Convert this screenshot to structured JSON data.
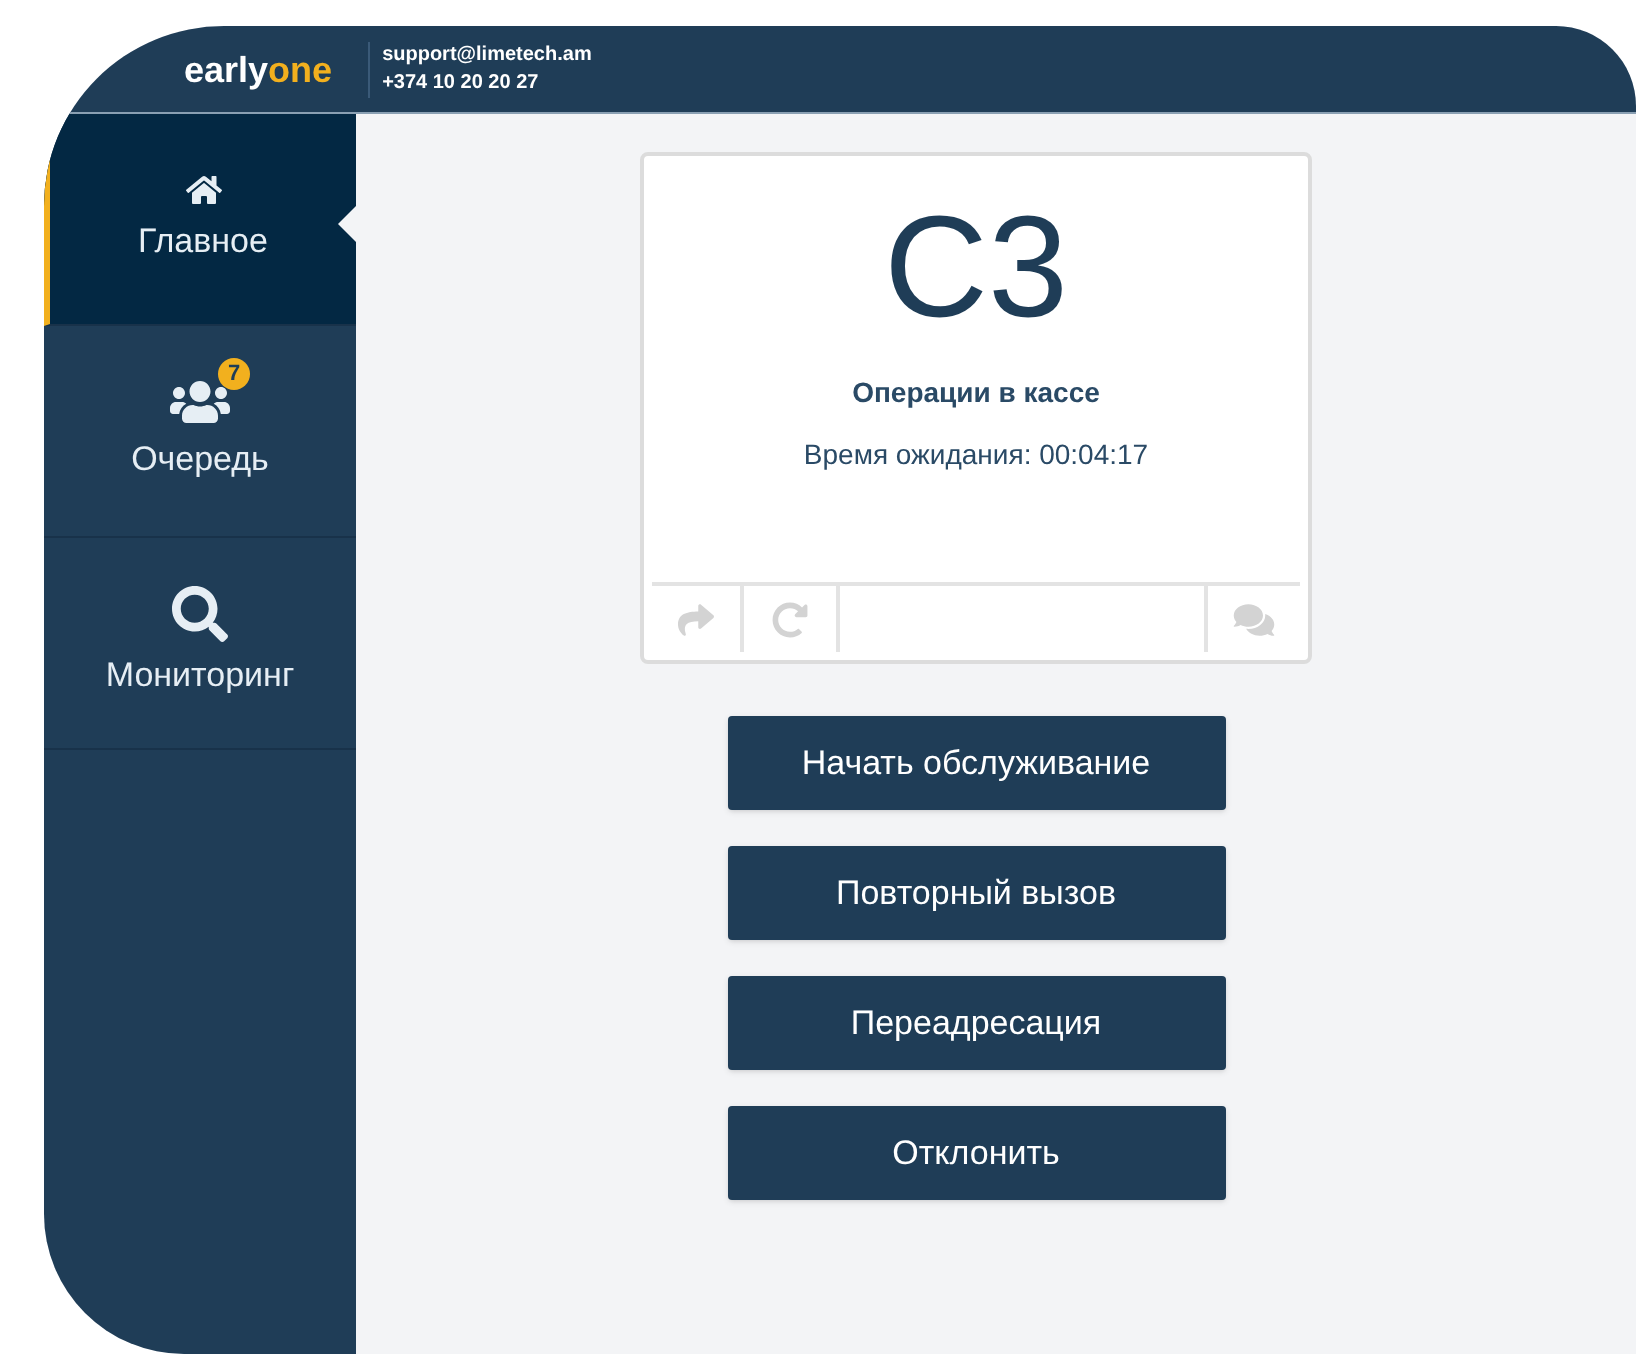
{
  "header": {
    "logo": {
      "first": "early",
      "second": "one"
    },
    "email": "support@limetech.am",
    "phone": "+374 10 20 20 27"
  },
  "sidebar": {
    "items": [
      {
        "kind": "home",
        "label": "Главное",
        "selected": true
      },
      {
        "kind": "queue",
        "label": "Очередь",
        "selected": false,
        "badge": "7"
      },
      {
        "kind": "search",
        "label": "Мониторинг",
        "selected": false
      }
    ]
  },
  "ticket": {
    "number": "C3",
    "service": "Операции в кассе",
    "wait": "Время ожидания: 00:04:17"
  },
  "buttons": [
    "Начать обслуживание",
    "Повторный вызов",
    "Переадресация",
    "Отклонить"
  ]
}
